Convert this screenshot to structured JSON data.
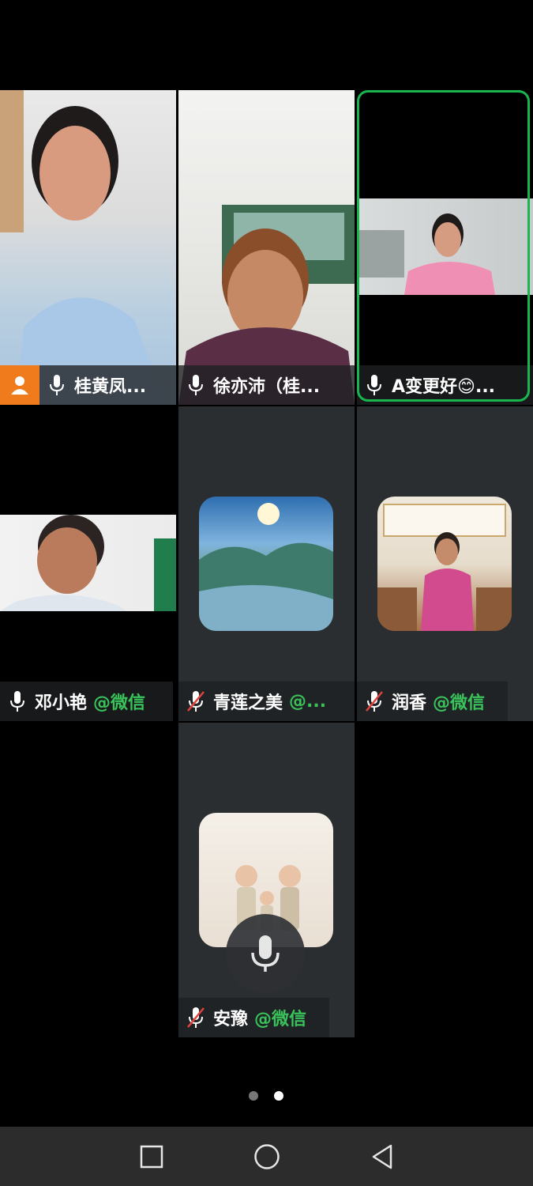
{
  "participants": [
    {
      "name": "桂黄凤...",
      "wx_tag": "",
      "mic": "on",
      "host": true,
      "type": "video"
    },
    {
      "name": "徐亦沛（桂...",
      "wx_tag": "",
      "mic": "on",
      "host": false,
      "type": "video"
    },
    {
      "name": "A变更好😊...",
      "wx_tag": "",
      "mic": "on",
      "host": false,
      "type": "video",
      "speaking": true
    },
    {
      "name": "邓小艳",
      "wx_tag": "@微信",
      "mic": "on",
      "host": false,
      "type": "video"
    },
    {
      "name": "青莲之美",
      "wx_tag": "@...",
      "mic": "muted",
      "host": false,
      "type": "avatar"
    },
    {
      "name": "润香",
      "wx_tag": "@微信",
      "mic": "muted",
      "host": false,
      "type": "avatar"
    },
    {
      "name": "安豫",
      "wx_tag": "@微信",
      "mic": "muted",
      "host": false,
      "type": "avatar"
    }
  ],
  "pagination": {
    "total": 2,
    "current": 2
  },
  "colors": {
    "active_speaker": "#19b64f",
    "wx_tag": "#39c35a",
    "host_badge": "#f07b1c"
  },
  "icons": {
    "nav": [
      "recent-apps-icon",
      "home-icon",
      "back-icon"
    ]
  }
}
